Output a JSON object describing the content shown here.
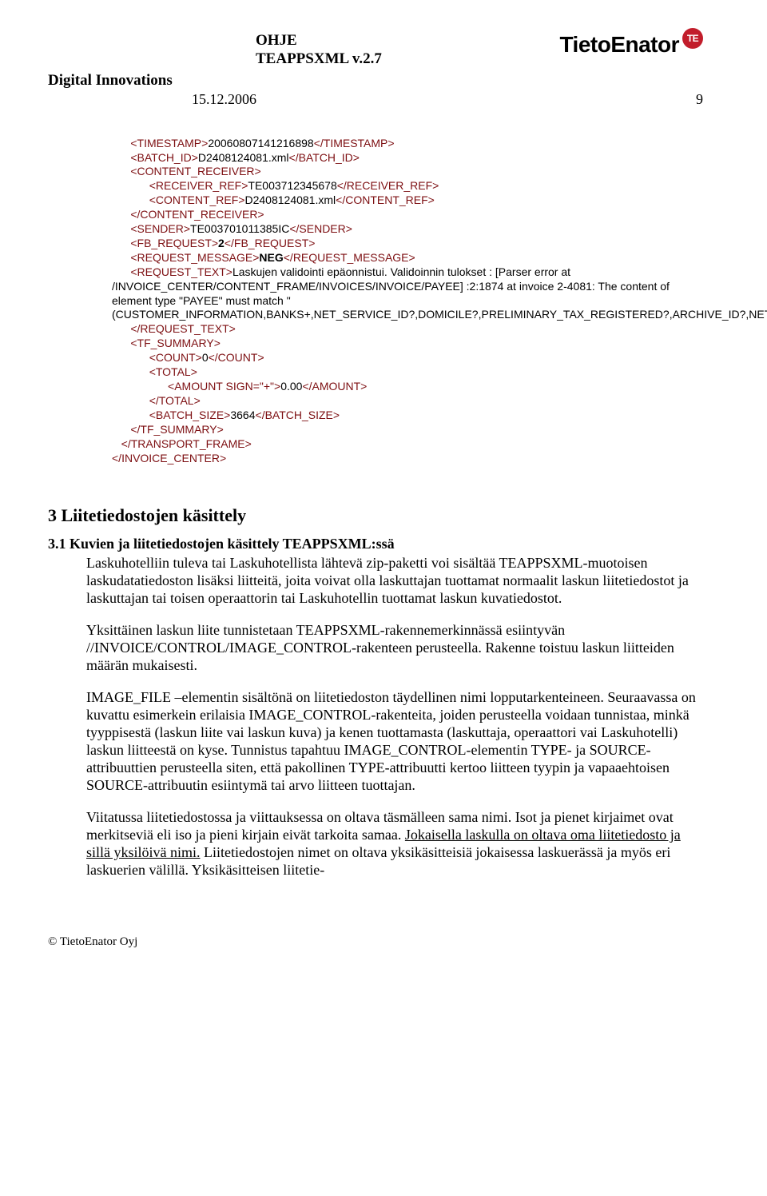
{
  "header": {
    "doc_type": "OHJE",
    "doc_title": "TEAPPSXML v.2.7",
    "brand": "TietoEnator",
    "brand_mark": "TE",
    "division": "Digital Innovations",
    "date": "15.12.2006",
    "page_number": "9"
  },
  "xml": {
    "timestamp_open": "<TIMESTAMP>",
    "timestamp_val": "20060807141216898",
    "timestamp_close": "</TIMESTAMP>",
    "batchid_open": "<BATCH_ID>",
    "batchid_val": "D2408124081.xml",
    "batchid_close": "</BATCH_ID>",
    "cr_open": "<CONTENT_RECEIVER>",
    "rr_open": "<RECEIVER_REF>",
    "rr_val": "TE003712345678",
    "rr_close": "</RECEIVER_REF>",
    "cref_open": "<CONTENT_REF>",
    "cref_val": "D2408124081.xml",
    "cref_close": "</CONTENT_REF>",
    "cr_close": "</CONTENT_RECEIVER>",
    "sender_open": "<SENDER>",
    "sender_val": "TE003701011385IC",
    "sender_close": "</SENDER>",
    "fb_open": "<FB_REQUEST>",
    "fb_val": "2",
    "fb_close": "</FB_REQUEST>",
    "rm_open": "<REQUEST_MESSAGE>",
    "rm_val": "NEG",
    "rm_close": "</REQUEST_MESSAGE>",
    "rt_open": "<REQUEST_TEXT>",
    "rt_val": "Laskujen validointi epäonnistui. Validoinnin tulokset : [Parser error at /INVOICE_CENTER/CONTENT_FRAME/INVOICES/INVOICE/PAYEE] :2:1874 at invoice 2-4081: The content of element type \"PAYEE\" must match \"(CUSTOMER_INFORMATION,BANKS+,NET_SERVICE_ID?,DOMICILE?,PRELIMINARY_TAX_REGISTERED?,ARCHIVE_ID?,NETTING_CODE?,PAYEE_REFERENCE?,METHOD_OF_PAYMENT?,DETAILS_OF_PAYMENT?,BANK_BARCODE?)\".",
    "rt_close": "</REQUEST_TEXT>",
    "tf_open": "<TF_SUMMARY>",
    "count_open": "<COUNT>",
    "count_val": "0",
    "count_close": "</COUNT>",
    "total_open": "<TOTAL>",
    "amount_open": "<AMOUNT SIGN=\"+\">",
    "amount_val": "0.00",
    "amount_close": "</AMOUNT>",
    "total_close": "</TOTAL>",
    "bs_open": "<BATCH_SIZE>",
    "bs_val": "3664",
    "bs_close": "</BATCH_SIZE>",
    "tf_close": "</TF_SUMMARY>",
    "tp_close": "</TRANSPORT_FRAME>",
    "ic_close": "</INVOICE_CENTER>"
  },
  "section3": {
    "title": "3 Liitetiedostojen käsittely",
    "sub_title": "3.1 Kuvien ja liitetiedostojen käsittely TEAPPSXML:ssä",
    "p1": "Laskuhotelliin tuleva tai Laskuhotellista lähtevä zip-paketti voi sisältää TEAPPSXML-muotoisen laskudatatiedoston lisäksi liitteitä, joita voivat olla laskuttajan tuottamat normaalit laskun liitetiedostot ja laskuttajan tai toisen operaattorin tai Laskuhotellin tuottamat laskun kuvatiedostot.",
    "p2": "Yksittäinen laskun liite tunnistetaan TEAPPSXML-rakennemerkinnässä esiintyvän //INVOICE/CONTROL/IMAGE_CONTROL-rakenteen perusteella. Rakenne toistuu laskun liitteiden määrän mukaisesti.",
    "p3": "IMAGE_FILE –elementin sisältönä on liitetiedoston täydellinen nimi lopputarkenteineen. Seuraavassa on kuvattu esimerkein erilaisia IMAGE_CONTROL-rakenteita, joiden perusteella voidaan tunnistaa, minkä tyyppisestä (laskun liite vai laskun kuva) ja kenen tuottamasta (laskuttaja, operaattori vai Laskuhotelli) laskun liitteestä on kyse. Tunnistus tapahtuu IMAGE_CONTROL-elementin TYPE- ja SOURCE-attribuuttien perusteella siten, että pakollinen TYPE-attribuutti kertoo liitteen tyypin ja vapaaehtoisen SOURCE-attribuutin esiintymä tai arvo liitteen tuottajan.",
    "p4a": "Viitatussa liitetiedostossa ja viittauksessa on oltava täsmälleen sama nimi. Isot ja pienet kirjaimet ovat merkitseviä eli iso ja pieni kirjain eivät tarkoita samaa. ",
    "p4u": "Jokaisella laskulla on oltava oma liitetiedosto ja sillä yksilöivä nimi.",
    "p4b": " Liitetiedostojen nimet on oltava yksikäsitteisiä jokaisessa laskuerässä ja myös eri laskuerien välillä. Yksikäsitteisen liitetie-"
  },
  "footer": "© TietoEnator Oyj"
}
